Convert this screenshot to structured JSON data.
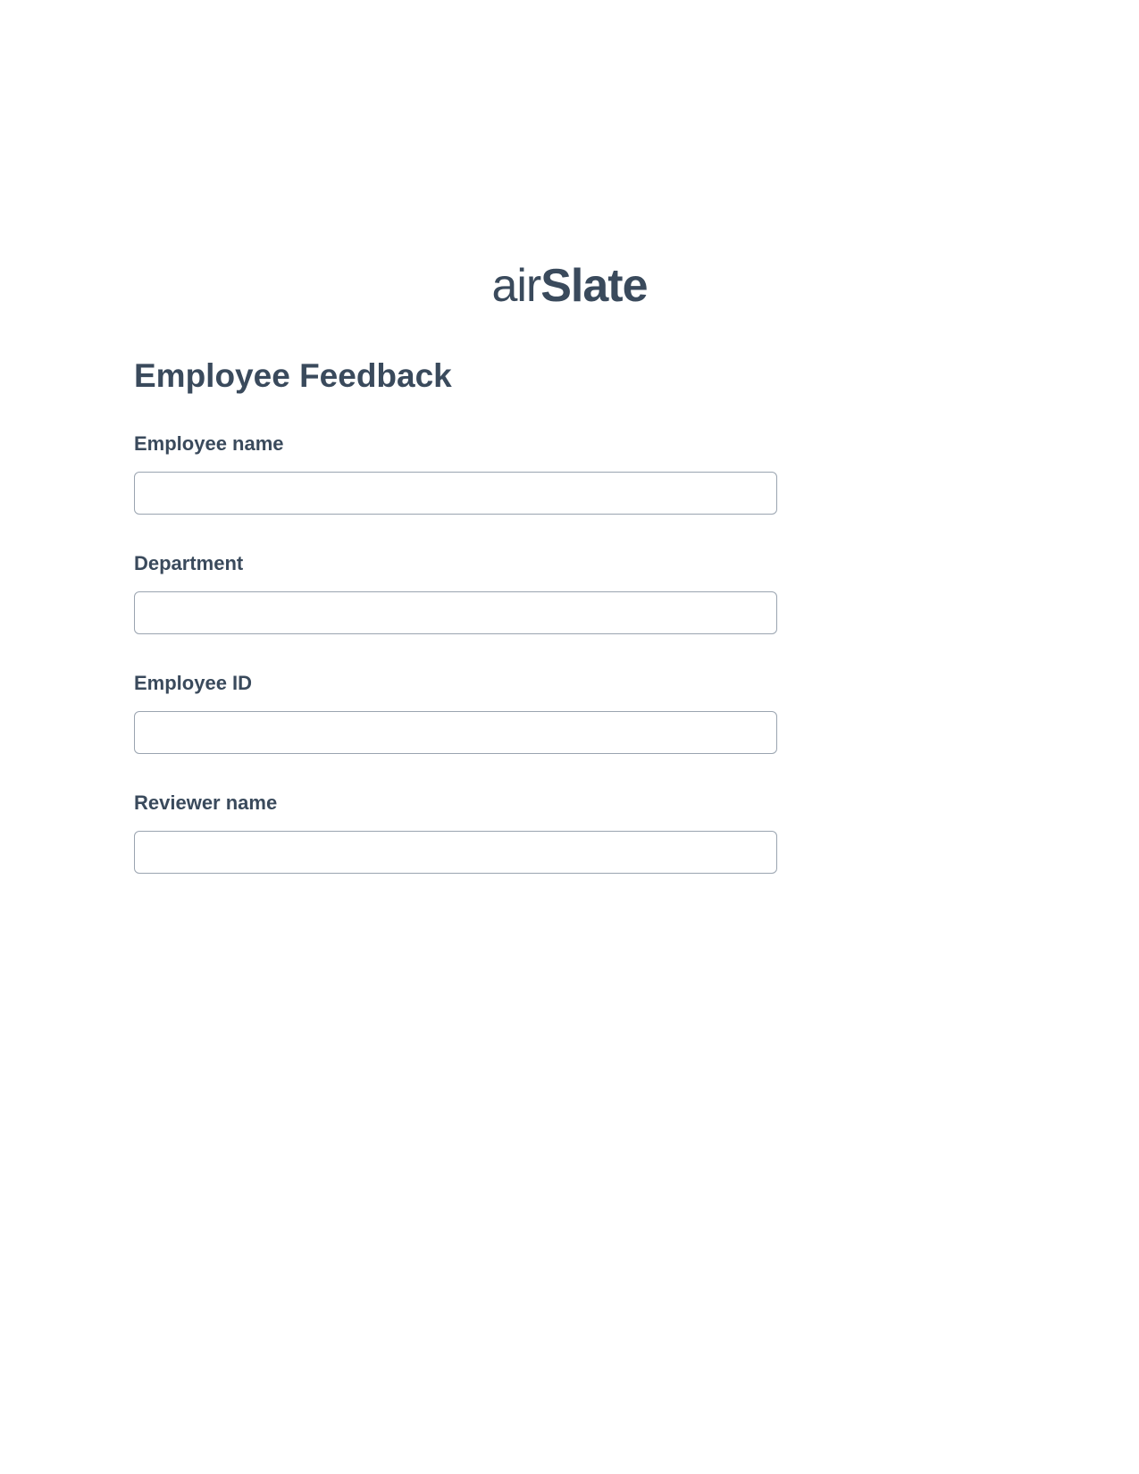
{
  "logo": {
    "part1": "air",
    "part2": "Slate"
  },
  "form": {
    "title": "Employee Feedback",
    "fields": [
      {
        "label": "Employee name",
        "value": ""
      },
      {
        "label": "Department",
        "value": ""
      },
      {
        "label": "Employee ID",
        "value": ""
      },
      {
        "label": "Reviewer name",
        "value": ""
      }
    ]
  }
}
